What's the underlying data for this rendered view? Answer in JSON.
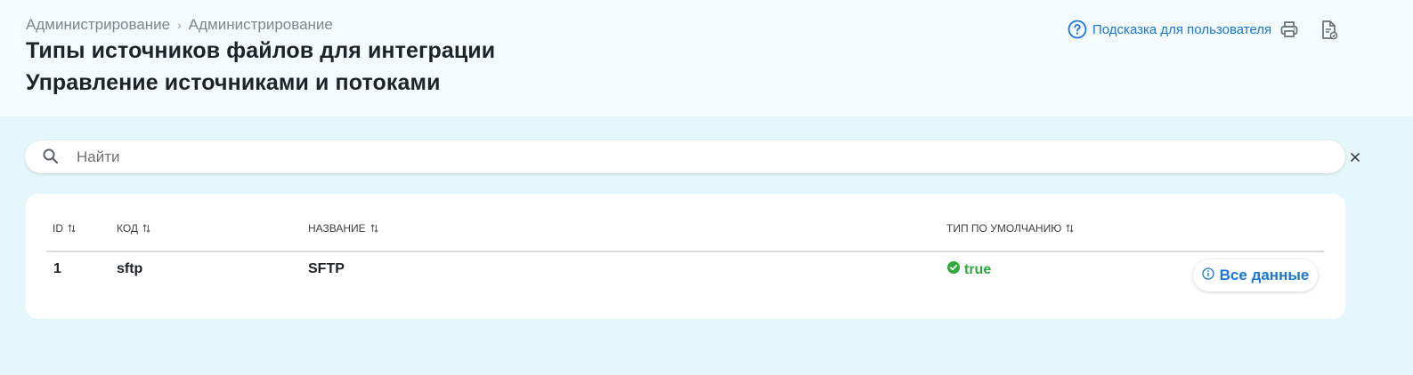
{
  "breadcrumb": {
    "items": [
      "Администрирование",
      "Администрирование"
    ],
    "separator": "›"
  },
  "page": {
    "title": "Типы источников файлов для интеграции",
    "subtitle": "Управление источниками и потоками"
  },
  "header_actions": {
    "help_label": "Подсказка для пользователя",
    "help_icon": "question-circle-icon",
    "print_icon": "printer-icon",
    "export_icon": "document-export-icon"
  },
  "search": {
    "placeholder": "Найти",
    "value": ""
  },
  "table": {
    "columns": [
      "ID",
      "КОД",
      "НАЗВАНИЕ",
      "ТИП ПО УМОЛЧАНИЮ"
    ],
    "rows": [
      {
        "id": "1",
        "code": "sftp",
        "name": "SFTP",
        "default_type": "true",
        "action_label": "Все данные"
      }
    ]
  },
  "colors": {
    "accent": "#1976d2",
    "success": "#2eaa3b",
    "page_bg": "#e5f7fd",
    "header_bg": "#f3fbfe"
  }
}
